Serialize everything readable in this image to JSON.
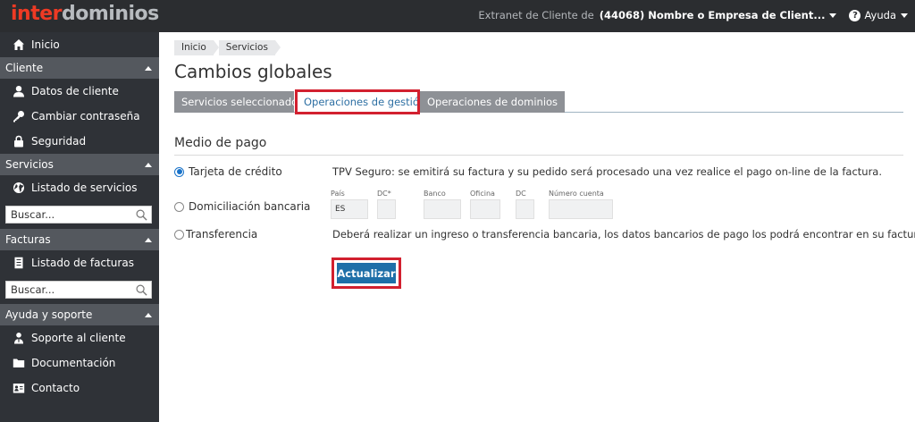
{
  "header": {
    "logo_part1": "inter",
    "logo_part2": "dominios",
    "extranet_label": "Extranet de Cliente de",
    "client_name": "(44068) Nombre o Empresa de Client...",
    "help_label": "Ayuda"
  },
  "sidebar": {
    "home": "Inicio",
    "sections": [
      {
        "title": "Cliente",
        "items": [
          "Datos de cliente",
          "Cambiar contraseña",
          "Seguridad"
        ]
      },
      {
        "title": "Servicios",
        "items": [
          "Listado de servicios"
        ],
        "search_placeholder": "Buscar..."
      },
      {
        "title": "Facturas",
        "items": [
          "Listado de facturas"
        ],
        "search_placeholder": "Buscar..."
      },
      {
        "title": "Ayuda y soporte",
        "items": [
          "Soporte al cliente",
          "Documentación",
          "Contacto"
        ]
      }
    ]
  },
  "main": {
    "breadcrumb": [
      "Inicio",
      "Servicios"
    ],
    "title": "Cambios globales",
    "tabs": [
      {
        "label": "Servicios seleccionados",
        "active": false
      },
      {
        "label": "Operaciones de gestión",
        "active": true
      },
      {
        "label": "Operaciones de dominios",
        "active": false
      }
    ],
    "section_title": "Medio de pago",
    "payment_options": [
      {
        "label": "Tarjeta de crédito",
        "selected": true
      },
      {
        "label": "Domiciliación bancaria",
        "selected": false
      },
      {
        "label": "Transferencia",
        "selected": false
      }
    ],
    "card_description": "TPV Seguro: se emitirá su factura y su pedido será procesado una vez realice el pago on-line de la factura.",
    "bank_fields": [
      {
        "label": "País",
        "value": "ES"
      },
      {
        "label": "DC*",
        "value": ""
      },
      {
        "label": "Banco",
        "value": ""
      },
      {
        "label": "Oficina",
        "value": ""
      },
      {
        "label": "DC",
        "value": ""
      },
      {
        "label": "Número cuenta",
        "value": ""
      }
    ],
    "transfer_description": "Deberá realizar un ingreso o transferencia bancaria, los datos bancarios de pago los podrá encontrar en su factura.",
    "submit_label": "Actualizar"
  },
  "colors": {
    "topbar": "#2b2d30",
    "sidebar": "#2f3237",
    "sidebar_header": "#54585e",
    "logo_red": "#ee3a24",
    "accent_blue": "#1f6fa8",
    "highlight_red": "#d2202f"
  }
}
